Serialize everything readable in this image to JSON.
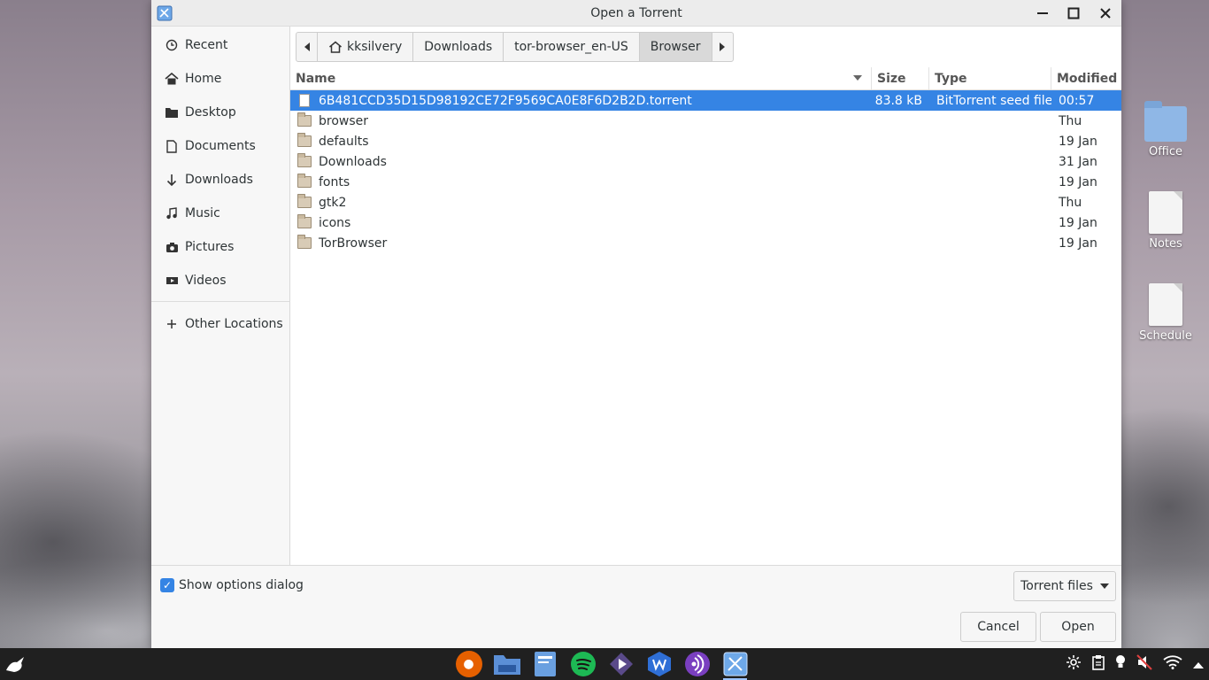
{
  "window": {
    "title": "Open a Torrent"
  },
  "sidebar": {
    "items": [
      {
        "label": "Recent",
        "icon": "clock-icon"
      },
      {
        "label": "Home",
        "icon": "home-icon"
      },
      {
        "label": "Desktop",
        "icon": "folder-icon"
      },
      {
        "label": "Documents",
        "icon": "document-icon"
      },
      {
        "label": "Downloads",
        "icon": "download-icon"
      },
      {
        "label": "Music",
        "icon": "music-icon"
      },
      {
        "label": "Pictures",
        "icon": "camera-icon"
      },
      {
        "label": "Videos",
        "icon": "video-icon"
      }
    ],
    "other_locations": "Other Locations"
  },
  "pathbar": {
    "segments": [
      "kksilvery",
      "Downloads",
      "tor-browser_en-US",
      "Browser"
    ],
    "active_index": 3
  },
  "list": {
    "columns": {
      "name": "Name",
      "size": "Size",
      "type": "Type",
      "modified": "Modified"
    },
    "rows": [
      {
        "name": "6B481CCD35D15D98192CE72F9569CA0E8F6D2B2D.torrent",
        "size": "83.8 kB",
        "type": "BitTorrent seed file",
        "modified": "00:57",
        "kind": "file",
        "selected": true
      },
      {
        "name": "browser",
        "size": "",
        "type": "",
        "modified": "Thu",
        "kind": "folder"
      },
      {
        "name": "defaults",
        "size": "",
        "type": "",
        "modified": "19 Jan",
        "kind": "folder"
      },
      {
        "name": "Downloads",
        "size": "",
        "type": "",
        "modified": "31 Jan",
        "kind": "folder"
      },
      {
        "name": "fonts",
        "size": "",
        "type": "",
        "modified": "19 Jan",
        "kind": "folder"
      },
      {
        "name": "gtk2",
        "size": "",
        "type": "",
        "modified": "Thu",
        "kind": "folder"
      },
      {
        "name": "icons",
        "size": "",
        "type": "",
        "modified": "19 Jan",
        "kind": "folder"
      },
      {
        "name": "TorBrowser",
        "size": "",
        "type": "",
        "modified": "19 Jan",
        "kind": "folder"
      }
    ]
  },
  "footer": {
    "show_options_label": "Show options dialog",
    "show_options_checked": true,
    "filter_label": "Torrent files",
    "cancel_label": "Cancel",
    "open_label": "Open"
  },
  "desktop": {
    "icons": [
      {
        "label": "Office",
        "kind": "folder"
      },
      {
        "label": "Notes",
        "kind": "document"
      },
      {
        "label": "Schedule",
        "kind": "document"
      }
    ]
  },
  "taskbar": {
    "apps": [
      {
        "name": "firefox-icon",
        "color": "#e66000"
      },
      {
        "name": "file-manager-icon",
        "color": "#5b8fd6"
      },
      {
        "name": "notes-app-icon",
        "color": "#6aa0e0"
      },
      {
        "name": "spotify-icon",
        "color": "#1db954"
      },
      {
        "name": "media-player-icon",
        "color": "#5a4a8a"
      },
      {
        "name": "wps-office-icon",
        "color": "#2f6fd6"
      },
      {
        "name": "podcast-icon",
        "color": "#7a3fc0"
      },
      {
        "name": "torrent-app-icon",
        "color": "#6ea8e8"
      }
    ],
    "tray": [
      "settings-icon",
      "clipboard-icon",
      "lightbulb-icon",
      "mute-icon",
      "wifi-icon",
      "tray-up-icon"
    ]
  },
  "colors": {
    "accent": "#3584e4"
  }
}
